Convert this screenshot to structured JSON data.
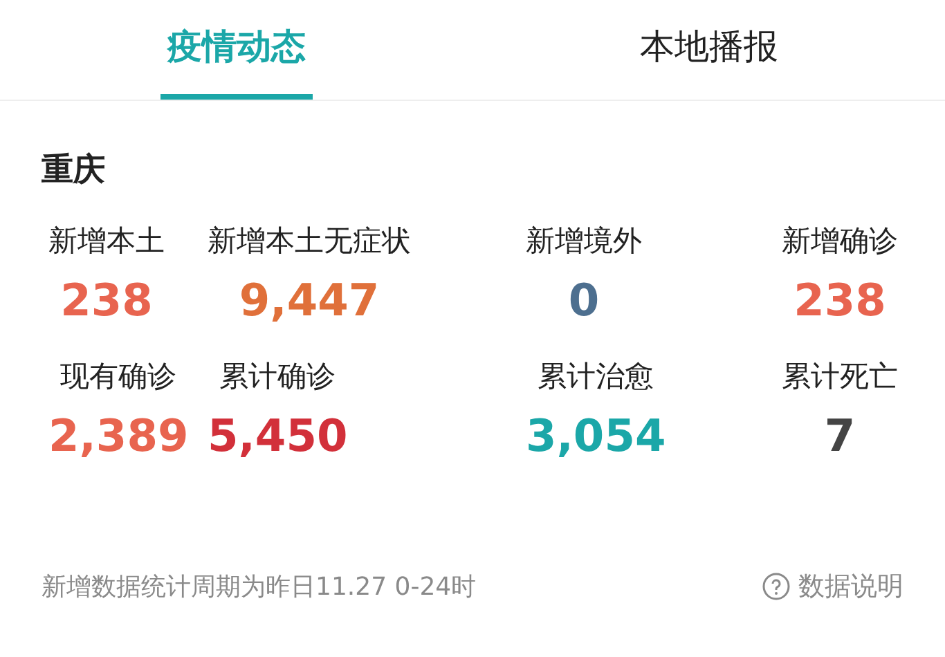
{
  "tabs": [
    {
      "label": "疫情动态",
      "selected": true
    },
    {
      "label": "本地播报",
      "selected": false
    }
  ],
  "region": "重庆",
  "stats": [
    {
      "label": "新增本土",
      "value": "238",
      "color": "#e8644f"
    },
    {
      "label": "新增本土无症状",
      "value": "9,447",
      "color": "#e0703a"
    },
    {
      "label": "新增境外",
      "value": "0",
      "color": "#4d6f8f"
    },
    {
      "label": "新增确诊",
      "value": "238",
      "color": "#e8644f"
    },
    {
      "label": "现有确诊",
      "value": "2,389",
      "color": "#e8644f"
    },
    {
      "label": "累计确诊",
      "value": "5,450",
      "color": "#d2303a"
    },
    {
      "label": "累计治愈",
      "value": "3,054",
      "color": "#1ba7a8"
    },
    {
      "label": "累计死亡",
      "value": "7",
      "color": "#444444"
    }
  ],
  "footer": {
    "note": "新增数据统计周期为昨日11.27 0-24时",
    "help": "数据说明"
  }
}
